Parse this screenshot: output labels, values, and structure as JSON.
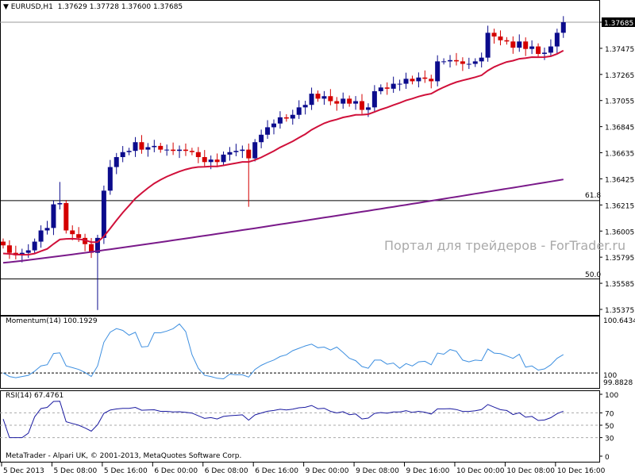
{
  "header": {
    "symbol": "EURUSD,H1",
    "open": "1.37629",
    "high": "1.37728",
    "low": "1.37600",
    "close": "1.37685"
  },
  "indicators": {
    "momentum_label": "Momentum(14) 100.1929",
    "rsi_label": "RSI(14) 67.4761"
  },
  "levels": {
    "fib_618": "61.8",
    "fib_50": "50.0"
  },
  "watermark": "Портал для трейдеров - ForTrader.ru",
  "copyright": "MetaTrader - Alpari UK, © 2001-2013, MetaQuotes Software Corp.",
  "colors": {
    "bull": "#0b0b8c",
    "bear": "#d40000",
    "ma_fast": "#d0103a",
    "ma_slow": "#7a1a8a",
    "momentum": "#3d8fe0",
    "rsi": "#1a1aa0"
  },
  "chart_data": {
    "type": "candlestick",
    "symbol": "EURUSD",
    "timeframe": "H1",
    "current_price": "1.37685",
    "price_ticks": [
      "1.37685",
      "1.37475",
      "1.37265",
      "1.37055",
      "1.36845",
      "1.36635",
      "1.36425",
      "1.36215",
      "1.36005",
      "1.35795",
      "1.35585",
      "1.35375"
    ],
    "price_range": [
      1.353,
      1.3785
    ],
    "fib_levels": [
      {
        "label": "61.8",
        "price": 1.3625
      },
      {
        "label": "50.0",
        "price": 1.3562
      }
    ],
    "time_labels": [
      "5 Dec 2013",
      "5 Dec 08:00",
      "5 Dec 16:00",
      "6 Dec 00:00",
      "6 Dec 08:00",
      "6 Dec 16:00",
      "9 Dec 00:00",
      "9 Dec 08:00",
      "9 Dec 16:00",
      "10 Dec 00:00",
      "10 Dec 08:00",
      "10 Dec 16:00"
    ],
    "closes": [
      1.3589,
      1.3583,
      1.3581,
      1.3583,
      1.3585,
      1.3592,
      1.3601,
      1.3603,
      1.3622,
      1.3623,
      1.3601,
      1.3598,
      1.3595,
      1.359,
      1.3583,
      1.3595,
      1.3633,
      1.3652,
      1.366,
      1.3664,
      1.3665,
      1.3672,
      1.3666,
      1.3668,
      1.3669,
      1.3666,
      1.3666,
      1.3665,
      1.3666,
      1.3665,
      1.3664,
      1.366,
      1.3656,
      1.3658,
      1.3656,
      1.3662,
      1.3664,
      1.3665,
      1.3666,
      1.3659,
      1.3672,
      1.3678,
      1.3684,
      1.3687,
      1.3692,
      1.3691,
      1.3694,
      1.37,
      1.3702,
      1.3711,
      1.3707,
      1.3709,
      1.3705,
      1.3703,
      1.3707,
      1.3703,
      1.3705,
      1.3698,
      1.37,
      1.3713,
      1.3716,
      1.3715,
      1.3719,
      1.3719,
      1.3723,
      1.3721,
      1.3724,
      1.3723,
      1.3721,
      1.3737,
      1.3737,
      1.3738,
      1.3737,
      1.3735,
      1.3735,
      1.3737,
      1.374,
      1.376,
      1.3757,
      1.3754,
      1.3753,
      1.3748,
      1.3753,
      1.3747,
      1.3749,
      1.3743,
      1.3744,
      1.3749,
      1.376,
      1.37685
    ],
    "ma_slow_range": [
      1.3575,
      1.3642
    ],
    "momentum": {
      "period": 14,
      "value": 100.1929,
      "axis_max": "100.6434",
      "axis_min": "99.8828",
      "level": "100"
    },
    "rsi": {
      "period": 14,
      "value": 67.4761,
      "ticks": [
        "100",
        "70",
        "50",
        "30",
        "0"
      ]
    }
  }
}
